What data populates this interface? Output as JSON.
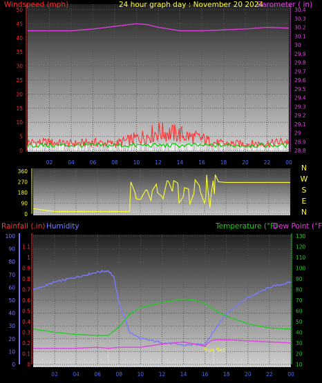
{
  "header": {
    "title": "24 hour graph day : November 20 2024",
    "left_label": "Windspeed (mph)",
    "right_label": "Barometer ( in)"
  },
  "colors": {
    "background": "#000000",
    "wind": "#ff2a2a",
    "gust_band": "#00cc00",
    "wind_white": "#ffffff",
    "barometer": "#e040e0",
    "direction": "#ffff33",
    "humidity": "#7a7aff",
    "temperature": "#22cc22",
    "dewpoint": "#e040e0",
    "rainfall": "#ff3333",
    "axis_time": "#4a6cff"
  },
  "chart_data": [
    {
      "type": "line",
      "name_left": "Windspeed (mph)",
      "name_right": "Barometer ( in)",
      "x_ticks": [
        "02",
        "04",
        "06",
        "08",
        "10",
        "12",
        "14",
        "16",
        "18",
        "20",
        "22",
        "00"
      ],
      "y_left_ticks": [
        0,
        5,
        10,
        15,
        20,
        25,
        30,
        35,
        40,
        45,
        50
      ],
      "y_right_ticks": [
        28.8,
        28.9,
        29,
        29.1,
        29.2,
        29.3,
        29.4,
        29.5,
        29.6,
        29.7,
        29.8,
        29.9,
        30,
        30.1,
        30.2,
        30.3,
        30.4
      ],
      "ylim_left": [
        0,
        50
      ],
      "ylim_right": [
        28.8,
        30.4
      ],
      "barometer_hours": [
        0,
        2,
        4,
        6,
        8,
        10,
        11,
        12,
        14,
        16,
        18,
        20,
        22,
        24
      ],
      "barometer_values": [
        30.16,
        30.16,
        30.16,
        30.18,
        30.21,
        30.24,
        30.23,
        30.2,
        30.16,
        30.16,
        30.17,
        30.18,
        30.2,
        30.19
      ],
      "wind_hours": [
        0,
        2,
        4,
        6,
        8,
        9,
        10,
        11,
        12,
        13,
        14,
        15,
        16,
        17,
        18,
        20,
        22,
        24
      ],
      "wind_values": [
        3,
        3,
        2.5,
        3,
        2.5,
        3.5,
        4.5,
        5.5,
        7,
        6.5,
        6,
        5,
        4.5,
        3,
        2.5,
        2.5,
        2.5,
        3.5
      ]
    },
    {
      "type": "line",
      "name": "Wind direction",
      "x_ticks": [
        "02",
        "04",
        "06",
        "08",
        "10",
        "12",
        "14",
        "16",
        "18",
        "20",
        "22",
        "00"
      ],
      "y_ticks": [
        0,
        90,
        180,
        270,
        360
      ],
      "compass": [
        "N",
        "W",
        "S",
        "E",
        "N"
      ],
      "ylim": [
        0,
        360
      ],
      "hours": [
        0,
        2,
        4,
        6,
        8,
        9,
        9.5,
        10,
        10.5,
        11,
        11.5,
        12,
        12.5,
        13,
        13.5,
        14,
        14.5,
        15,
        15.5,
        16,
        16.2,
        16.5,
        16.8,
        17,
        17.3,
        18,
        20,
        22,
        24
      ],
      "values": [
        45,
        20,
        20,
        20,
        20,
        20,
        180,
        120,
        200,
        110,
        250,
        150,
        280,
        190,
        260,
        140,
        210,
        170,
        240,
        90,
        330,
        50,
        280,
        330,
        270,
        265,
        265,
        265,
        265
      ]
    },
    {
      "type": "line",
      "left_label_1": "Rainfall (.in)",
      "left_label_2": "Humidity",
      "right_label_1": "Temperature (°F)",
      "right_label_2": "Dew Point (°F)",
      "x_ticks": [
        "02",
        "04",
        "06",
        "08",
        "10",
        "12",
        "14",
        "16",
        "18",
        "20",
        "22",
        "00"
      ],
      "humidity_ticks": [
        0,
        10,
        20,
        30,
        40,
        50,
        60,
        70,
        80,
        90,
        100
      ],
      "rain_ticks": [
        0,
        0.1,
        0.2,
        0.3,
        0.4,
        0.5,
        0.6,
        0.7,
        0.8,
        0.9,
        1,
        1.1
      ],
      "temp_ticks": [
        10,
        20,
        30,
        40,
        50,
        60,
        70,
        80,
        90,
        100,
        110,
        120,
        130
      ],
      "ylim_humidity": [
        0,
        100
      ],
      "ylim_temp": [
        10,
        130
      ],
      "annotation": "Sun Set",
      "series": [
        {
          "name": "Humidity",
          "hours": [
            0,
            2,
            4,
            6,
            7,
            7.5,
            8,
            9,
            10,
            12,
            14,
            16,
            17,
            18,
            20,
            22,
            24
          ],
          "values": [
            58,
            64,
            68,
            72,
            73,
            68,
            48,
            25,
            20,
            17,
            15,
            16,
            28,
            40,
            52,
            60,
            64
          ]
        },
        {
          "name": "Temperature",
          "hours": [
            0,
            2,
            4,
            6,
            7,
            8,
            9,
            10,
            12,
            14,
            15,
            16,
            17,
            18,
            20,
            22,
            24
          ],
          "values": [
            43,
            40,
            38,
            37,
            37,
            45,
            57,
            63,
            68,
            71,
            70,
            67,
            60,
            55,
            48,
            44,
            43
          ]
        },
        {
          "name": "Dew Point",
          "hours": [
            0,
            2,
            4,
            6,
            7,
            8,
            10,
            12,
            14,
            16,
            16.5,
            17,
            18,
            20,
            22,
            24
          ],
          "values": [
            25,
            25,
            25,
            26,
            25,
            26,
            26,
            29,
            31,
            27,
            32,
            33,
            33,
            32,
            31,
            30
          ]
        }
      ]
    }
  ]
}
